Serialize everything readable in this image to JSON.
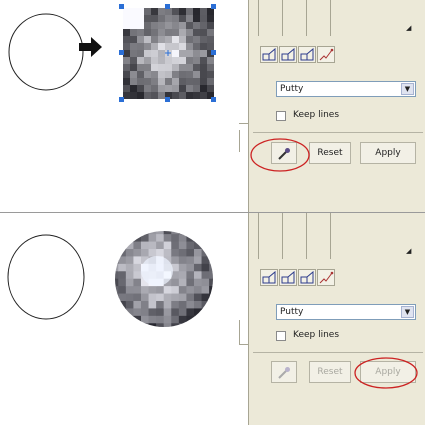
{
  "top": {
    "dropdown_value": "Putty",
    "checkbox_label": "Keep lines",
    "reset_label": "Reset",
    "apply_label": "Apply",
    "arrow_icon": "right-arrow-icon",
    "eyedropper_icon": "eyedropper-icon",
    "highlighted_control": "eyedropper-button"
  },
  "bottom": {
    "dropdown_value": "Putty",
    "checkbox_label": "Keep lines",
    "reset_label": "Reset",
    "apply_label": "Apply",
    "eyedropper_icon": "eyedropper-icon",
    "highlighted_control": "apply-button"
  },
  "colors": {
    "panel": "#ece9d8",
    "highlight_ellipse": "#cc2222",
    "selection_handles": "#2b6fd6"
  }
}
